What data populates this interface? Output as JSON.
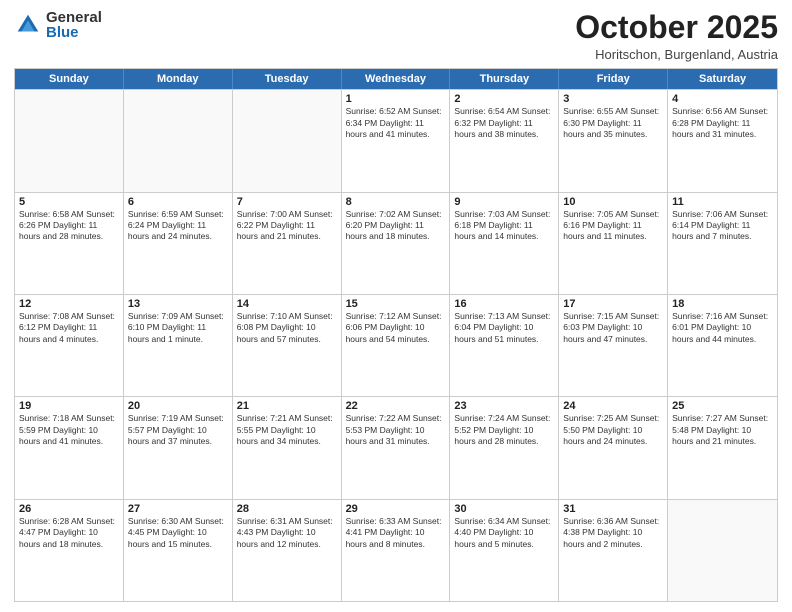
{
  "logo": {
    "general": "General",
    "blue": "Blue"
  },
  "header": {
    "month": "October 2025",
    "location": "Horitschon, Burgenland, Austria"
  },
  "days": [
    "Sunday",
    "Monday",
    "Tuesday",
    "Wednesday",
    "Thursday",
    "Friday",
    "Saturday"
  ],
  "rows": [
    [
      {
        "day": "",
        "content": ""
      },
      {
        "day": "",
        "content": ""
      },
      {
        "day": "",
        "content": ""
      },
      {
        "day": "1",
        "content": "Sunrise: 6:52 AM\nSunset: 6:34 PM\nDaylight: 11 hours\nand 41 minutes."
      },
      {
        "day": "2",
        "content": "Sunrise: 6:54 AM\nSunset: 6:32 PM\nDaylight: 11 hours\nand 38 minutes."
      },
      {
        "day": "3",
        "content": "Sunrise: 6:55 AM\nSunset: 6:30 PM\nDaylight: 11 hours\nand 35 minutes."
      },
      {
        "day": "4",
        "content": "Sunrise: 6:56 AM\nSunset: 6:28 PM\nDaylight: 11 hours\nand 31 minutes."
      }
    ],
    [
      {
        "day": "5",
        "content": "Sunrise: 6:58 AM\nSunset: 6:26 PM\nDaylight: 11 hours\nand 28 minutes."
      },
      {
        "day": "6",
        "content": "Sunrise: 6:59 AM\nSunset: 6:24 PM\nDaylight: 11 hours\nand 24 minutes."
      },
      {
        "day": "7",
        "content": "Sunrise: 7:00 AM\nSunset: 6:22 PM\nDaylight: 11 hours\nand 21 minutes."
      },
      {
        "day": "8",
        "content": "Sunrise: 7:02 AM\nSunset: 6:20 PM\nDaylight: 11 hours\nand 18 minutes."
      },
      {
        "day": "9",
        "content": "Sunrise: 7:03 AM\nSunset: 6:18 PM\nDaylight: 11 hours\nand 14 minutes."
      },
      {
        "day": "10",
        "content": "Sunrise: 7:05 AM\nSunset: 6:16 PM\nDaylight: 11 hours\nand 11 minutes."
      },
      {
        "day": "11",
        "content": "Sunrise: 7:06 AM\nSunset: 6:14 PM\nDaylight: 11 hours\nand 7 minutes."
      }
    ],
    [
      {
        "day": "12",
        "content": "Sunrise: 7:08 AM\nSunset: 6:12 PM\nDaylight: 11 hours\nand 4 minutes."
      },
      {
        "day": "13",
        "content": "Sunrise: 7:09 AM\nSunset: 6:10 PM\nDaylight: 11 hours\nand 1 minute."
      },
      {
        "day": "14",
        "content": "Sunrise: 7:10 AM\nSunset: 6:08 PM\nDaylight: 10 hours\nand 57 minutes."
      },
      {
        "day": "15",
        "content": "Sunrise: 7:12 AM\nSunset: 6:06 PM\nDaylight: 10 hours\nand 54 minutes."
      },
      {
        "day": "16",
        "content": "Sunrise: 7:13 AM\nSunset: 6:04 PM\nDaylight: 10 hours\nand 51 minutes."
      },
      {
        "day": "17",
        "content": "Sunrise: 7:15 AM\nSunset: 6:03 PM\nDaylight: 10 hours\nand 47 minutes."
      },
      {
        "day": "18",
        "content": "Sunrise: 7:16 AM\nSunset: 6:01 PM\nDaylight: 10 hours\nand 44 minutes."
      }
    ],
    [
      {
        "day": "19",
        "content": "Sunrise: 7:18 AM\nSunset: 5:59 PM\nDaylight: 10 hours\nand 41 minutes."
      },
      {
        "day": "20",
        "content": "Sunrise: 7:19 AM\nSunset: 5:57 PM\nDaylight: 10 hours\nand 37 minutes."
      },
      {
        "day": "21",
        "content": "Sunrise: 7:21 AM\nSunset: 5:55 PM\nDaylight: 10 hours\nand 34 minutes."
      },
      {
        "day": "22",
        "content": "Sunrise: 7:22 AM\nSunset: 5:53 PM\nDaylight: 10 hours\nand 31 minutes."
      },
      {
        "day": "23",
        "content": "Sunrise: 7:24 AM\nSunset: 5:52 PM\nDaylight: 10 hours\nand 28 minutes."
      },
      {
        "day": "24",
        "content": "Sunrise: 7:25 AM\nSunset: 5:50 PM\nDaylight: 10 hours\nand 24 minutes."
      },
      {
        "day": "25",
        "content": "Sunrise: 7:27 AM\nSunset: 5:48 PM\nDaylight: 10 hours\nand 21 minutes."
      }
    ],
    [
      {
        "day": "26",
        "content": "Sunrise: 6:28 AM\nSunset: 4:47 PM\nDaylight: 10 hours\nand 18 minutes."
      },
      {
        "day": "27",
        "content": "Sunrise: 6:30 AM\nSunset: 4:45 PM\nDaylight: 10 hours\nand 15 minutes."
      },
      {
        "day": "28",
        "content": "Sunrise: 6:31 AM\nSunset: 4:43 PM\nDaylight: 10 hours\nand 12 minutes."
      },
      {
        "day": "29",
        "content": "Sunrise: 6:33 AM\nSunset: 4:41 PM\nDaylight: 10 hours\nand 8 minutes."
      },
      {
        "day": "30",
        "content": "Sunrise: 6:34 AM\nSunset: 4:40 PM\nDaylight: 10 hours\nand 5 minutes."
      },
      {
        "day": "31",
        "content": "Sunrise: 6:36 AM\nSunset: 4:38 PM\nDaylight: 10 hours\nand 2 minutes."
      },
      {
        "day": "",
        "content": ""
      }
    ]
  ]
}
